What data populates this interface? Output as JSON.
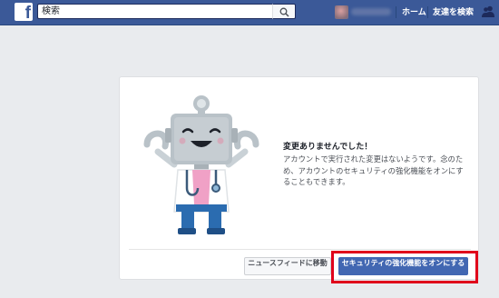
{
  "topbar": {
    "logo_letter": "f",
    "search": {
      "value": "検索",
      "placeholder": "検索"
    },
    "nav": {
      "home": "ホーム",
      "find_friends": "友達を検索"
    }
  },
  "card": {
    "title": "変更ありませんでした！",
    "body": "アカウントで実行された変更はないようです。念のため、アカウントのセキュリティの強化機能をオンにすることもできます。",
    "buttons": {
      "news_feed": "ニュースフィードに移動",
      "security": "セキュリティの強化機能をオンにする"
    }
  },
  "colors": {
    "brand": "#3b5998",
    "primary_button": "#4267b2",
    "highlight": "#e0001b",
    "page_bg": "#e9ebee"
  },
  "icons": [
    "facebook-logo-icon",
    "search-icon",
    "friend-requests-icon",
    "robot-doctor-illustration"
  ]
}
